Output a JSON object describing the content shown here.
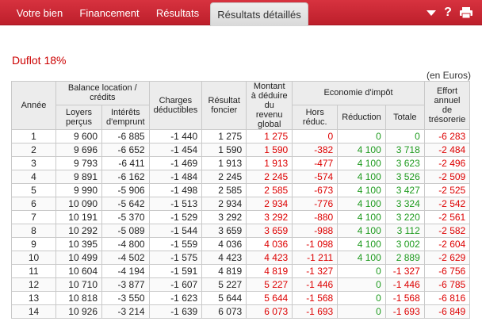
{
  "nav": {
    "tabs": [
      {
        "label": "Votre bien",
        "active": false
      },
      {
        "label": "Financement",
        "active": false
      },
      {
        "label": "Résultats",
        "active": false
      },
      {
        "label": "Résultats détaillés",
        "active": true
      }
    ],
    "tools": {
      "menu_icon": "caret-down-icon",
      "help_icon": "help-icon",
      "print_icon": "printer-icon"
    }
  },
  "title": "Duflot 18%",
  "unit_note": "(en Euros)",
  "colors": {
    "brand": "#c8232f",
    "negative": "#dd0000",
    "positive": "#1e9a1e"
  },
  "table": {
    "headers": {
      "annee": "Année",
      "balance_group": "Balance location / crédits",
      "loyers": "Loyers perçus",
      "interets": "Intérêts d'emprunt",
      "charges": "Charges déductibles",
      "resultat": "Résultat foncier",
      "montant": "Montant à déduire du revenu global",
      "eco_group": "Economie d'impôt",
      "hors": "Hors réduc.",
      "reduction": "Réduction",
      "totale": "Totale",
      "effort": "Effort annuel de trésorerie"
    },
    "rows": [
      [
        "1",
        "9 600",
        "-6 885",
        "-1 440",
        "1 275",
        "1 275",
        "0",
        "0",
        "0",
        "-6 283"
      ],
      [
        "2",
        "9 696",
        "-6 652",
        "-1 454",
        "1 590",
        "1 590",
        "-382",
        "4 100",
        "3 718",
        "-2 484"
      ],
      [
        "3",
        "9 793",
        "-6 411",
        "-1 469",
        "1 913",
        "1 913",
        "-477",
        "4 100",
        "3 623",
        "-2 496"
      ],
      [
        "4",
        "9 891",
        "-6 162",
        "-1 484",
        "2 245",
        "2 245",
        "-574",
        "4 100",
        "3 526",
        "-2 509"
      ],
      [
        "5",
        "9 990",
        "-5 906",
        "-1 498",
        "2 585",
        "2 585",
        "-673",
        "4 100",
        "3 427",
        "-2 525"
      ],
      [
        "6",
        "10 090",
        "-5 642",
        "-1 513",
        "2 934",
        "2 934",
        "-776",
        "4 100",
        "3 324",
        "-2 542"
      ],
      [
        "7",
        "10 191",
        "-5 370",
        "-1 529",
        "3 292",
        "3 292",
        "-880",
        "4 100",
        "3 220",
        "-2 561"
      ],
      [
        "8",
        "10 292",
        "-5 089",
        "-1 544",
        "3 659",
        "3 659",
        "-988",
        "4 100",
        "3 112",
        "-2 582"
      ],
      [
        "9",
        "10 395",
        "-4 800",
        "-1 559",
        "4 036",
        "4 036",
        "-1 098",
        "4 100",
        "3 002",
        "-2 604"
      ],
      [
        "10",
        "10 499",
        "-4 502",
        "-1 575",
        "4 423",
        "4 423",
        "-1 211",
        "4 100",
        "2 889",
        "-2 629"
      ],
      [
        "11",
        "10 604",
        "-4 194",
        "-1 591",
        "4 819",
        "4 819",
        "-1 327",
        "0",
        "-1 327",
        "-6 756"
      ],
      [
        "12",
        "10 710",
        "-3 877",
        "-1 607",
        "5 227",
        "5 227",
        "-1 446",
        "0",
        "-1 446",
        "-6 785"
      ],
      [
        "13",
        "10 818",
        "-3 550",
        "-1 623",
        "5 644",
        "5 644",
        "-1 568",
        "0",
        "-1 568",
        "-6 816"
      ],
      [
        "14",
        "10 926",
        "-3 214",
        "-1 639",
        "6 073",
        "6 073",
        "-1 693",
        "0",
        "-1 693",
        "-6 849"
      ]
    ]
  }
}
